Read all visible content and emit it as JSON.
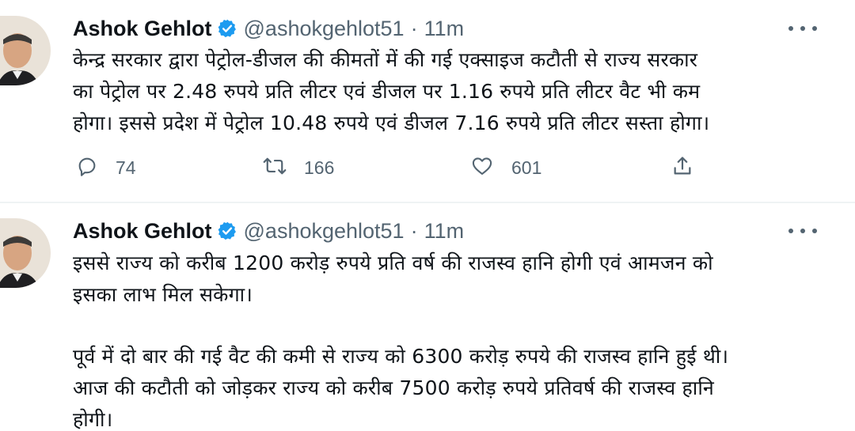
{
  "tweets": [
    {
      "author": "Ashok Gehlot",
      "handle": "@ashokgehlot51",
      "separator": "·",
      "time": "11m",
      "lines": [
        "केन्द्र सरकार द्वारा पेट्रोल-डीजल की कीमतों में की गई एक्साइज कटौती से राज्य सरकार",
        "का पेट्रोल पर 2.48 रुपये प्रति लीटर एवं डीजल पर 1.16 रुपये प्रति लीटर वैट भी कम",
        "होगा। इससे प्रदेश में पेट्रोल 10.48 रुपये एवं डीजल 7.16 रुपये प्रति लीटर सस्ता होगा।"
      ],
      "replies": "74",
      "retweets": "166",
      "likes": "601"
    },
    {
      "author": "Ashok Gehlot",
      "handle": "@ashokgehlot51",
      "separator": "·",
      "time": "11m",
      "paragraph1": [
        "इससे राज्य को करीब 1200 करोड़ रुपये प्रति वर्ष की राजस्व हानि होगी एवं आमजन को",
        "इसका लाभ मिल सकेगा।"
      ],
      "paragraph2": [
        "पूर्व में दो बार की गई वैट की कमी से राज्य को 6300 करोड़ रुपये की राजस्व हानि हुई थी।",
        "आज की कटौती को जोड़कर राज्य को करीब 7500 करोड़ रुपये प्रतिवर्ष की राजस्व हानि",
        "होगी।"
      ]
    }
  ],
  "icons": {
    "verified": "verified-badge-icon",
    "more": "more-options-icon",
    "reply": "reply-icon",
    "retweet": "retweet-icon",
    "like": "like-icon",
    "share": "share-icon"
  },
  "colors": {
    "text": "#0f1419",
    "secondary": "#536471",
    "verified": "#1d9bf0",
    "divider": "#eff3f4"
  }
}
